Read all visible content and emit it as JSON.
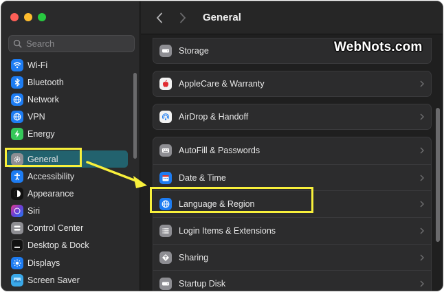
{
  "window": {
    "title": "General"
  },
  "sidebar": {
    "search_placeholder": "Search",
    "items": [
      {
        "label": "Wi-Fi",
        "icon": "wifi-icon",
        "color": "#1d7cf2"
      },
      {
        "label": "Bluetooth",
        "icon": "bluetooth-icon",
        "color": "#1d7cf2"
      },
      {
        "label": "Network",
        "icon": "globe-icon",
        "color": "#1d7cf2"
      },
      {
        "label": "VPN",
        "icon": "globe-icon",
        "color": "#1d7cf2"
      },
      {
        "label": "Energy",
        "icon": "lightning-icon",
        "color": "#35c759"
      },
      {
        "label": "General",
        "icon": "gear-icon",
        "color": "#8e8e93",
        "selected": true
      },
      {
        "label": "Accessibility",
        "icon": "accessibility-icon",
        "color": "#1d7cf2"
      },
      {
        "label": "Appearance",
        "icon": "appearance-icon",
        "color": "#111111"
      },
      {
        "label": "Siri",
        "icon": "siri-icon",
        "color": "#6b3fd6"
      },
      {
        "label": "Control Center",
        "icon": "control-center-icon",
        "color": "#8e8e93"
      },
      {
        "label": "Desktop & Dock",
        "icon": "dock-icon",
        "color": "#111111"
      },
      {
        "label": "Displays",
        "icon": "sun-icon",
        "color": "#1d7cf2"
      },
      {
        "label": "Screen Saver",
        "icon": "screen-saver-icon",
        "color": "#3aa8e8"
      }
    ]
  },
  "main": {
    "rows": [
      {
        "label": "Storage",
        "icon": "storage-icon",
        "color": "#8e8e93"
      },
      {
        "label": "AppleCare & Warranty",
        "icon": "apple-icon",
        "color": "#e8e8e8"
      },
      {
        "label": "AirDrop & Handoff",
        "icon": "airdrop-icon",
        "color": "#e8e8e8"
      },
      {
        "label": "AutoFill & Passwords",
        "icon": "keyboard-icon",
        "color": "#8e8e93"
      },
      {
        "label": "Date & Time",
        "icon": "calendar-icon",
        "color": "#1d7cf2"
      },
      {
        "label": "Language & Region",
        "icon": "globe-icon",
        "color": "#1d7cf2"
      },
      {
        "label": "Login Items & Extensions",
        "icon": "list-icon",
        "color": "#8e8e93"
      },
      {
        "label": "Sharing",
        "icon": "sharing-icon",
        "color": "#8e8e93"
      },
      {
        "label": "Startup Disk",
        "icon": "disk-icon",
        "color": "#8e8e93"
      }
    ]
  },
  "annotation": {
    "highlight_color": "#f8f03b",
    "watermark": "WebNots.com"
  }
}
